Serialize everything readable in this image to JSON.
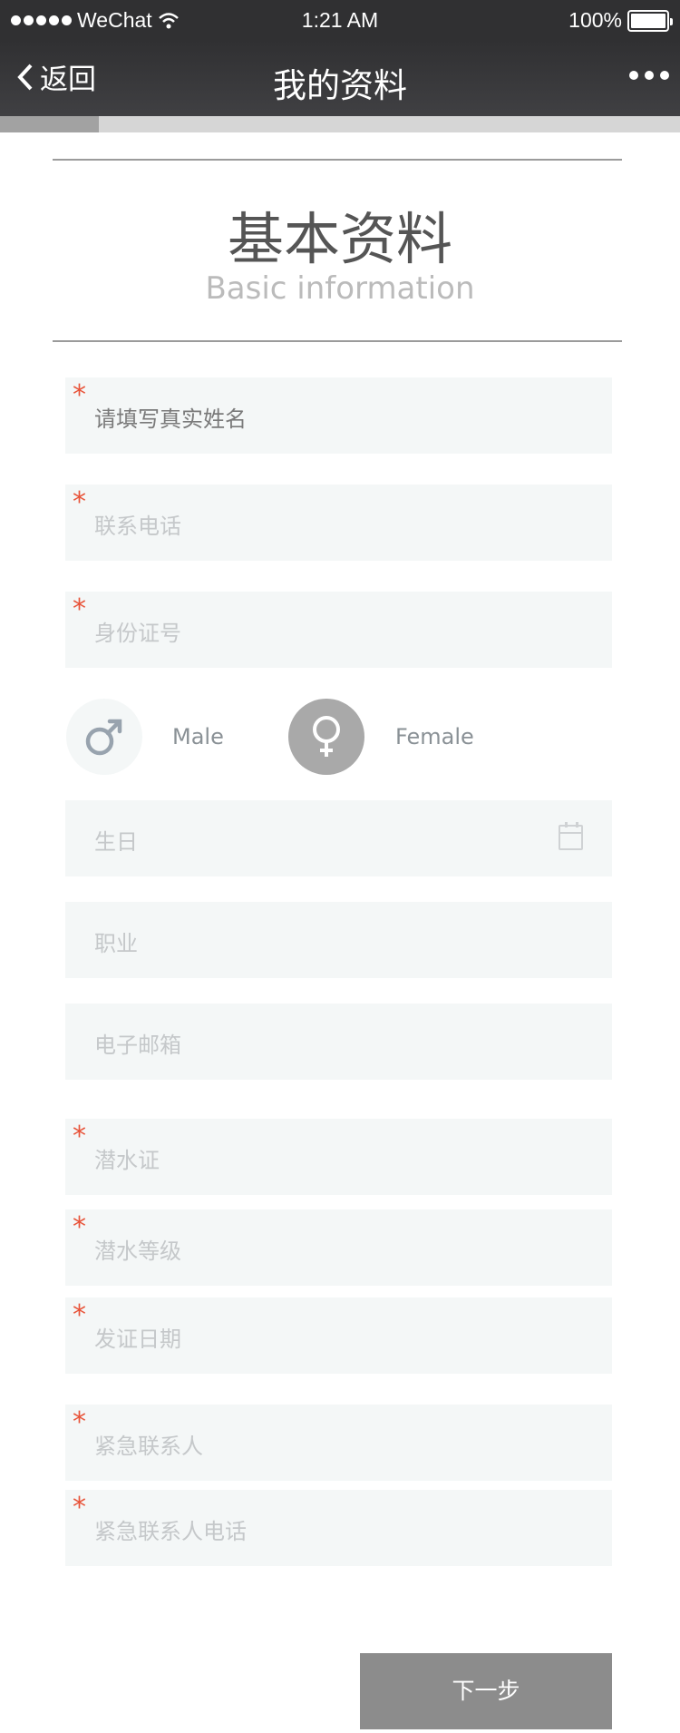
{
  "status_bar": {
    "carrier": "WeChat",
    "time": "1:21 AM",
    "battery": "100%"
  },
  "nav": {
    "back_label": "返回",
    "title": "我的资料"
  },
  "progress": {
    "fraction": 0.145
  },
  "heading": {
    "title_cn": "基本资料",
    "title_en": "Basic information"
  },
  "form": {
    "required_mark": "*",
    "name_placeholder": "请填写真实姓名",
    "phone_placeholder": "联系电话",
    "id_placeholder": "身份证号",
    "gender": {
      "male_label": "Male",
      "female_label": "Female",
      "selected": "female"
    },
    "birthday_placeholder": "生日",
    "occupation_placeholder": "职业",
    "email_placeholder": "电子邮箱",
    "dive_cert_placeholder": "潜水证",
    "dive_level_placeholder": "潜水等级",
    "cert_date_placeholder": "发证日期",
    "emergency_contact_placeholder": "紧急联系人",
    "emergency_phone_placeholder": "紧急联系人电话"
  },
  "actions": {
    "next_label": "下一步"
  },
  "colors": {
    "required": "#e8543a",
    "field_bg": "#f4f7f7",
    "button_bg": "#8c8c8c",
    "nav_bg": "#303032"
  }
}
